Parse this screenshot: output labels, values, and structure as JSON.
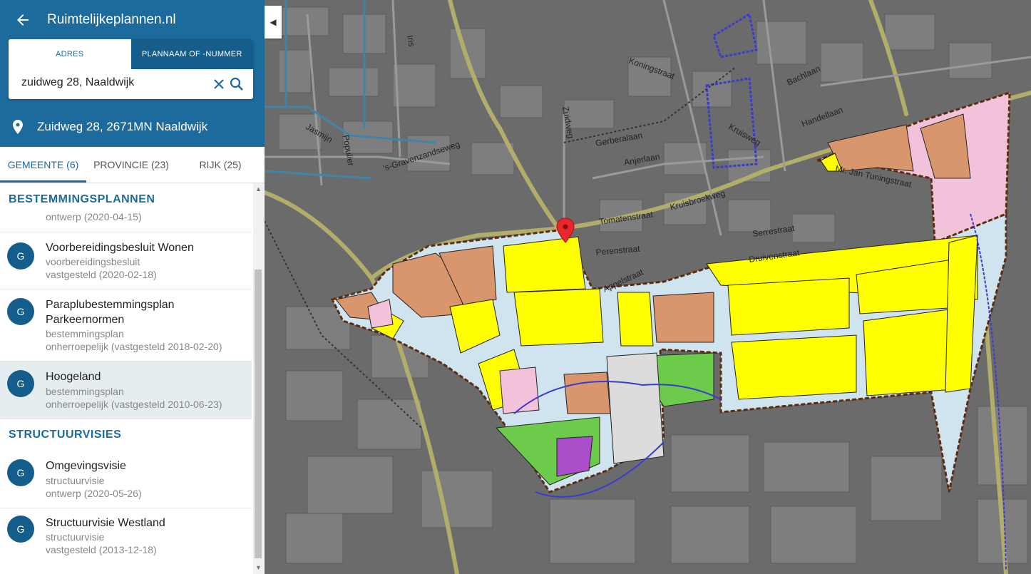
{
  "app": {
    "title": "Ruimtelijkeplannen.nl"
  },
  "search": {
    "tab_address": "ADRES",
    "tab_plan": "PLANNAAM OF -NUMMER",
    "value": "zuidweg 28, Naaldwijk"
  },
  "location": {
    "address": "Zuidweg 28, 2671MN Naaldwijk"
  },
  "tabs": [
    {
      "label": "GEMEENTE (6)"
    },
    {
      "label": "PROVINCIE (23)"
    },
    {
      "label": "RIJK (25)"
    }
  ],
  "sections": {
    "bestemmingsplannen": "BESTEMMINGSPLANNEN",
    "structuurvisies": "STRUCTUURVISIES"
  },
  "plans": [
    {
      "avatar": "G",
      "title": "",
      "type": "",
      "status": "ontwerp (2020-04-15)"
    },
    {
      "avatar": "G",
      "title": "Voorbereidingsbesluit Wonen",
      "type": "voorbereidingsbesluit",
      "status": "vastgesteld (2020-02-18)"
    },
    {
      "avatar": "G",
      "title": "Paraplubestemmingsplan Parkeernormen",
      "type": "bestemmingsplan",
      "status": "onherroepelijk (vastgesteld 2018-02-20)"
    },
    {
      "avatar": "G",
      "title": "Hoogeland",
      "type": "bestemmingsplan",
      "status": "onherroepelijk (vastgesteld 2010-06-23)"
    }
  ],
  "visions": [
    {
      "avatar": "G",
      "title": "Omgevingsvisie",
      "type": "structuurvisie",
      "status": "ontwerp (2020-05-26)"
    },
    {
      "avatar": "G",
      "title": "Structuurvisie Westland",
      "type": "structuurvisie",
      "status": "vastgesteld (2013-12-18)"
    }
  ],
  "map_labels": {
    "iris": "Iris",
    "koningstraat": "Koningstraat",
    "bachlaan": "Bachlaan",
    "handellaan": "Handellaan",
    "kruisweg": "Kruisweg",
    "gerberalaan": "Gerberalaan",
    "anjerlaan": "Anjerlaan",
    "jasmijn": "Jasmijn",
    "populier": "Populier",
    "gravenzandseweg": "'s-Gravenzandseweg",
    "zuidweg": "Zuidweg",
    "tomatenstraat": "Tomatenstraat",
    "kruisbroekweg": "Kruisbroekweg",
    "perenstraat": "Perenstraat",
    "serrestraat": "Serrestraat",
    "druivenstraat": "Druivenstraat",
    "appelstraat": "Appelstraat",
    "tuningstraat": "Mr. Jan Tuningstraat"
  },
  "colors": {
    "brand": "#1d6a9d",
    "brand_dark": "#155d8b",
    "zone_wonen": "#ffff00",
    "zone_bedrijf": "#d9956c",
    "zone_groen": "#6ccb4a",
    "zone_verkeer": "#cfe4ee",
    "zone_roze": "#f2c2da",
    "zone_paars": "#a94fc9",
    "marker": "#e8272e"
  },
  "icons": {
    "back": "arrow-left-icon",
    "clear": "close-icon",
    "search": "search-icon",
    "location": "map-pin-icon",
    "collapse": "chevron-left-icon",
    "marker": "map-marker-icon"
  }
}
